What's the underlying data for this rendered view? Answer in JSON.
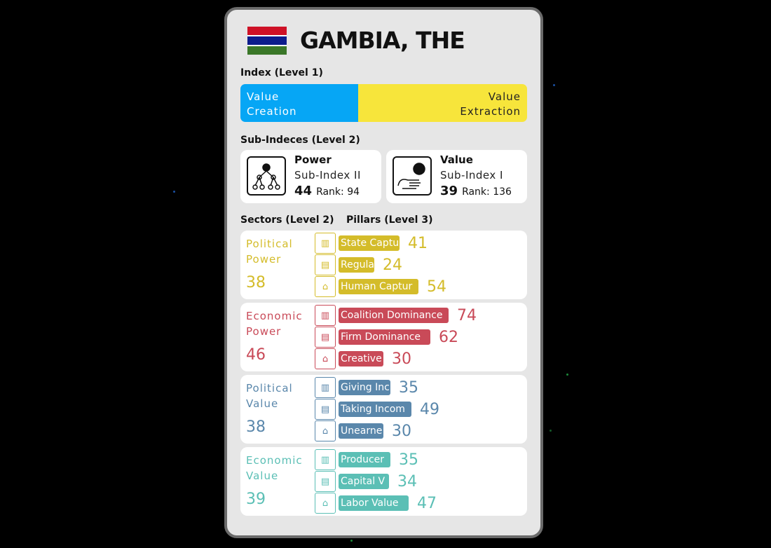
{
  "country": "GAMBIA, THE",
  "flag_colors": [
    "#ce1126",
    "#0c1c8c",
    "#3a7728"
  ],
  "index": {
    "heading": "Index (Level 1)",
    "left_label_1": "Value",
    "left_label_2": "Creation",
    "right_label_1": "Value",
    "right_label_2": "Extraction",
    "creation_color": "#06a6f5",
    "extraction_color": "#f7e53b"
  },
  "subindices": {
    "heading": "Sub-Indeces (Level 2)",
    "items": [
      {
        "name": "Power",
        "sub": "Sub-Index II",
        "score": "44",
        "rank": "Rank: 94",
        "icon": "network-hierarchy-icon"
      },
      {
        "name": "Value",
        "sub": "Sub-Index I",
        "score": "39",
        "rank": "Rank: 136",
        "icon": "hand-circle-icon"
      }
    ]
  },
  "sectors_heading": "Sectors (Level 2)",
  "pillars_heading": "Pillars (Level 3)",
  "sectors": [
    {
      "name1": "Political",
      "name2": "Power",
      "score": "38",
      "color": "#d4bc2a",
      "pillars": [
        {
          "label": "State Captu",
          "value": 41
        },
        {
          "label": "Regula",
          "value": 24
        },
        {
          "label": "Human Captur",
          "value": 54
        }
      ]
    },
    {
      "name1": "Economic",
      "name2": "Power",
      "score": "46",
      "color": "#c94a58",
      "pillars": [
        {
          "label": "Coalition Dominance",
          "value": 74
        },
        {
          "label": "Firm Dominance",
          "value": 62
        },
        {
          "label": "Creative",
          "value": 30
        }
      ]
    },
    {
      "name1": "Political",
      "name2": "Value",
      "score": "38",
      "color": "#5a87ab",
      "pillars": [
        {
          "label": "Giving Inc",
          "value": 35
        },
        {
          "label": "Taking Incom",
          "value": 49
        },
        {
          "label": "Unearne",
          "value": 30
        }
      ]
    },
    {
      "name1": "Economic",
      "name2": "Value",
      "score": "39",
      "color": "#5bbfb5",
      "pillars": [
        {
          "label": "Producer",
          "value": 35
        },
        {
          "label": "Capital V",
          "value": 34
        },
        {
          "label": "Labor Value",
          "value": 47
        }
      ]
    }
  ]
}
